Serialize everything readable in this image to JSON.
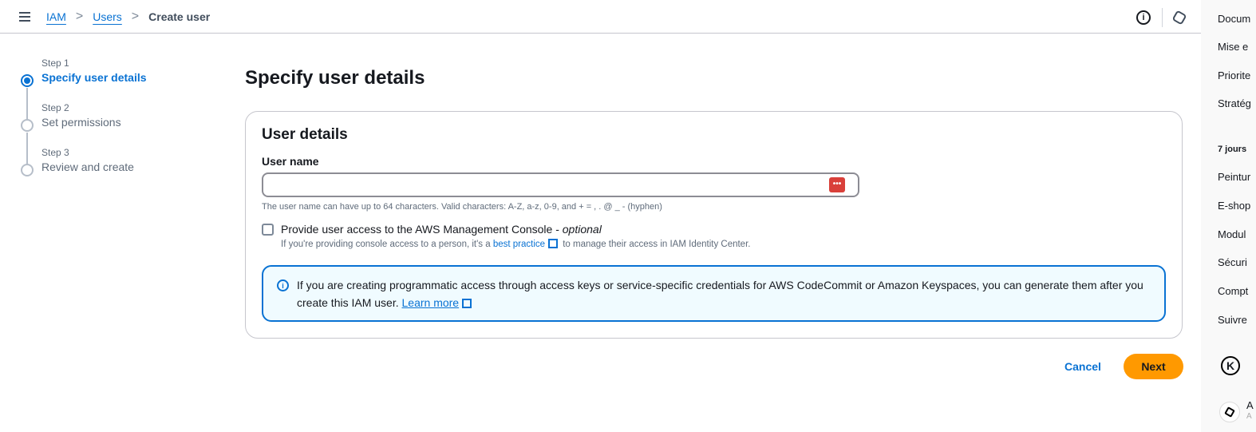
{
  "breadcrumb": {
    "items": [
      "IAM",
      "Users"
    ],
    "current": "Create user"
  },
  "steps": [
    {
      "n": "Step 1",
      "l": "Specify user details"
    },
    {
      "n": "Step 2",
      "l": "Set permissions"
    },
    {
      "n": "Step 3",
      "l": "Review and create"
    }
  ],
  "page_title": "Specify user details",
  "card": {
    "title": "User details",
    "user_name_label": "User name",
    "user_name_value": "",
    "hint": "The user name can have up to 64 characters. Valid characters: A-Z, a-z, 0-9, and + = , . @ _ - (hyphen)",
    "checkbox_label": "Provide user access to the AWS Management Console - ",
    "checkbox_optional": "optional",
    "sub_pre": "If you're providing console access to a person, it's a ",
    "sub_link": "best practice",
    "sub_post": " to manage their access in IAM Identity Center.",
    "alert_text": "If you are creating programmatic access through access keys or service-specific credentials for AWS CodeCommit or Amazon Keyspaces, you can generate them after you create this IAM user. ",
    "alert_link": "Learn more"
  },
  "actions": {
    "cancel": "Cancel",
    "next": "Next"
  },
  "side_panel": {
    "items": [
      "Docum",
      "Mise e",
      "Priorite",
      "Stratég"
    ],
    "header": "7 jours",
    "items2": [
      "Peintur",
      "E-shop",
      "Modul",
      "Sécuri",
      "Compt",
      "Suivre"
    ],
    "k_label": "K",
    "a_label": "A",
    "a_sub": "A"
  },
  "colors": {
    "accent": "#0972d3",
    "primary_button": "#ff9900"
  }
}
